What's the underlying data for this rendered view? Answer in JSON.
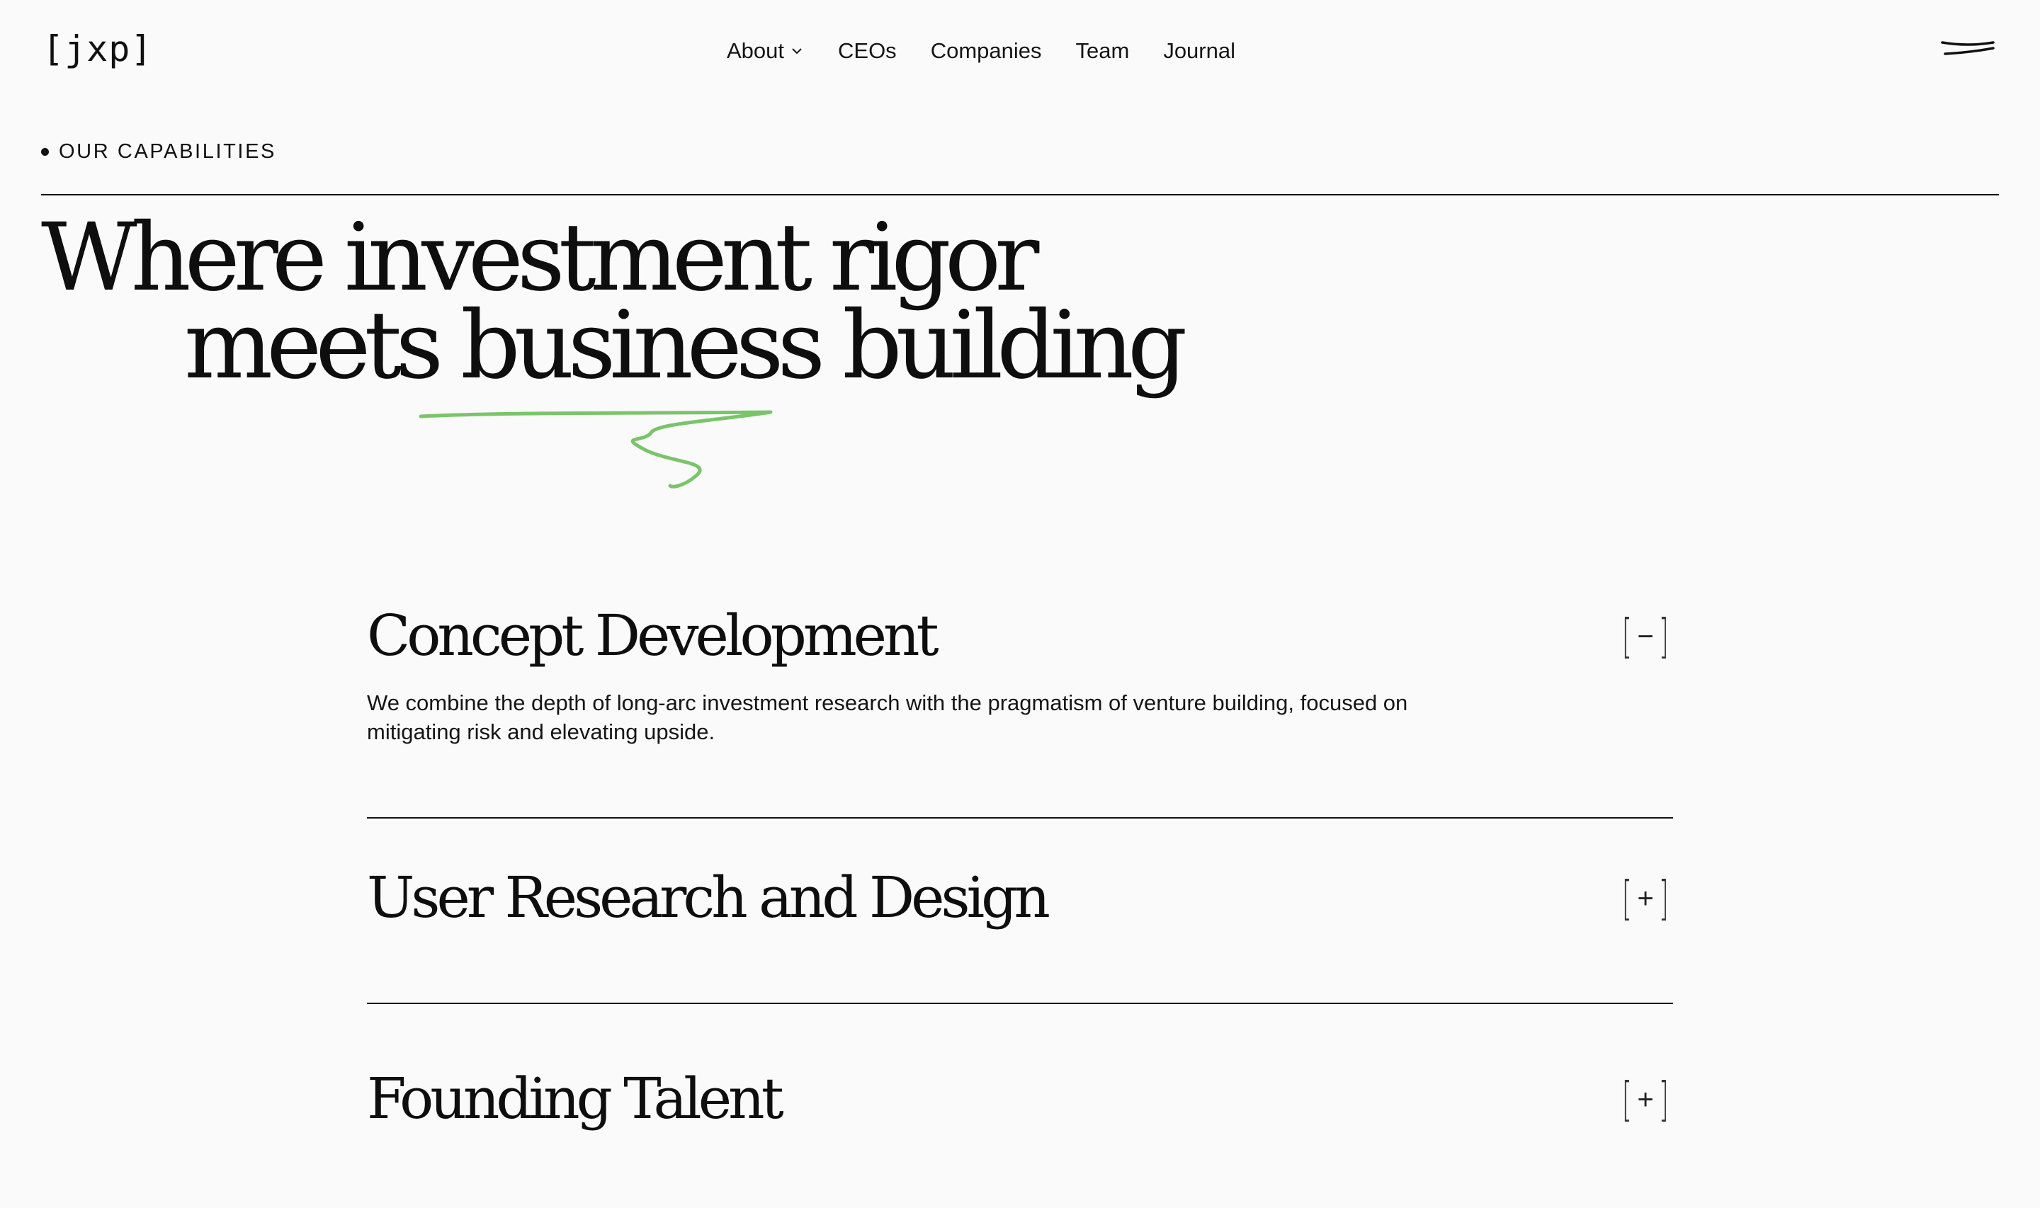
{
  "header": {
    "logo": "[jxp]",
    "nav": [
      {
        "label": "About",
        "has_dropdown": true
      },
      {
        "label": "CEOs"
      },
      {
        "label": "Companies"
      },
      {
        "label": "Team"
      },
      {
        "label": "Journal"
      }
    ],
    "menu_icon": "menu-lines-icon"
  },
  "section": {
    "label": "OUR CAPABILITIES"
  },
  "headline": {
    "line1": "Where investment rigor",
    "line2": "meets business building",
    "underline_color": "#7ac46a"
  },
  "capabilities": [
    {
      "title": "Concept Development",
      "description": "We combine the depth of long-arc investment research with the pragmatism of venture building, focused on mitigating risk and elevating upside.",
      "expanded": true,
      "toggle_open": "[",
      "toggle_symbol": "−",
      "toggle_close": "]"
    },
    {
      "title": "User Research and Design",
      "expanded": false,
      "toggle_open": "[",
      "toggle_symbol": "+",
      "toggle_close": "]"
    },
    {
      "title": "Founding Talent",
      "expanded": false,
      "toggle_open": "[",
      "toggle_symbol": "+",
      "toggle_close": "]"
    }
  ],
  "colors": {
    "background": "#fafafa",
    "text": "#111111",
    "accent_green": "#7ac46a"
  }
}
